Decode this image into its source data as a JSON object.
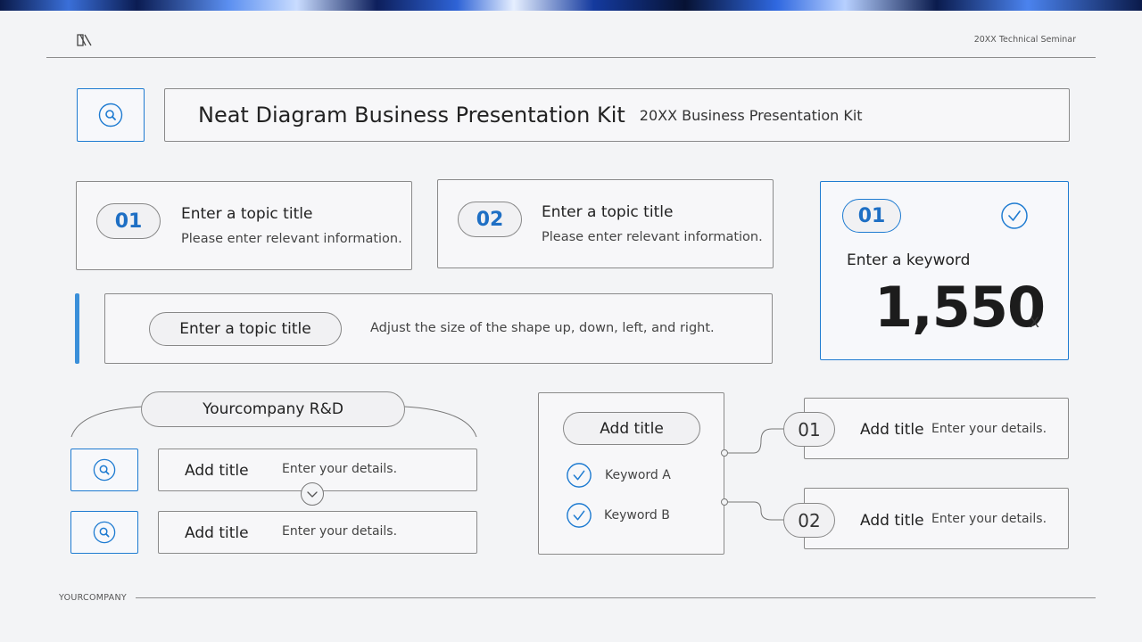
{
  "header": {
    "seminar": "20XX Technical Seminar"
  },
  "title_bar": {
    "title": "Neat Diagram Business Presentation Kit",
    "subtitle": "20XX Business Presentation Kit"
  },
  "topics": [
    {
      "num": "01",
      "title": "Enter a topic title",
      "desc": "Please enter relevant information."
    },
    {
      "num": "02",
      "title": "Enter a topic title",
      "desc": "Please enter relevant information."
    }
  ],
  "stat_card": {
    "num": "01",
    "label": "Enter a keyword",
    "value": "1,550",
    "unit": "X"
  },
  "wide_topic": {
    "title": "Enter a topic title",
    "desc": "Adjust the size of the shape up, down, left, and right."
  },
  "rd": {
    "title": "Yourcompany R&D",
    "rows": [
      {
        "title": "Add title",
        "desc": "Enter your details."
      },
      {
        "title": "Add title",
        "desc": "Enter your details."
      }
    ]
  },
  "keyword_panel": {
    "title": "Add title",
    "keywords": [
      "Keyword A",
      "Keyword B"
    ]
  },
  "branches": [
    {
      "num": "01",
      "title": "Add title",
      "desc": "Enter your details."
    },
    {
      "num": "02",
      "title": "Add title",
      "desc": "Enter your details."
    }
  ],
  "footer": {
    "company": "YOURCOMPANY"
  },
  "colors": {
    "accent": "#1e7bd1",
    "text": "#222222",
    "border": "#8a8a8a",
    "background": "#f3f4f6"
  },
  "icons": {
    "search": "search-icon",
    "check": "check-circle-icon",
    "chevron": "chevron-down-icon",
    "logo": "brand-logo-icon"
  }
}
